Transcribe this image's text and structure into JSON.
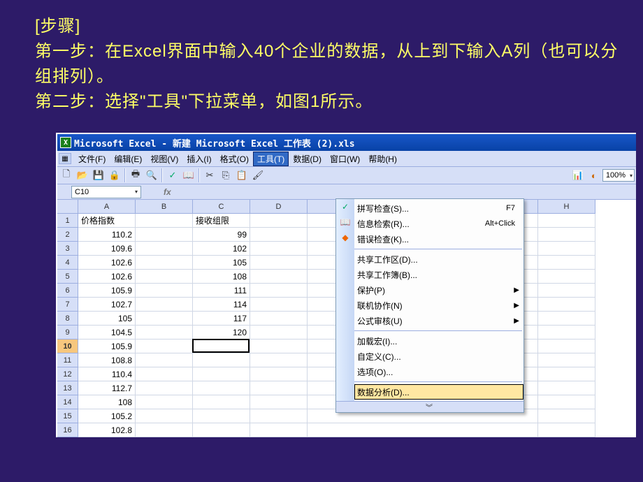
{
  "slide": {
    "heading": "[步骤]",
    "line1": "第一步：在Excel界面中输入40个企业的数据，从上到下输入A列（也可以分组排列）。",
    "line2": "第二步：选择\"工具\"下拉菜单，如图1所示。"
  },
  "title_bar": "Microsoft Excel - 新建 Microsoft Excel 工作表 (2).xls",
  "menu": {
    "file": "文件(F)",
    "edit": "编辑(E)",
    "view": "视图(V)",
    "insert": "插入(I)",
    "format": "格式(O)",
    "tools": "工具(T)",
    "data": "数据(D)",
    "window": "窗口(W)",
    "help": "帮助(H)"
  },
  "toolbar": {
    "zoom": "100%"
  },
  "namebox": "C10",
  "columns": {
    "A": "A",
    "B": "B",
    "C": "C",
    "D": "D",
    "H": "H"
  },
  "row_labels": [
    "1",
    "2",
    "3",
    "4",
    "5",
    "6",
    "7",
    "8",
    "9",
    "10",
    "11",
    "12",
    "13",
    "14",
    "15",
    "16"
  ],
  "cells": {
    "A1": "价格指数",
    "C1": "接收组限",
    "A2": "110.2",
    "C2": "99",
    "A3": "109.6",
    "C3": "102",
    "A4": "102.6",
    "C4": "105",
    "A5": "102.6",
    "C5": "108",
    "A6": "105.9",
    "C6": "111",
    "A7": "102.7",
    "C7": "114",
    "A8": "105",
    "C8": "117",
    "A9": "104.5",
    "C9": "120",
    "A10": "105.9",
    "A11": "108.8",
    "A12": "110.4",
    "A13": "112.7",
    "A14": "108",
    "A15": "105.2",
    "A16": "102.8"
  },
  "dropdown": {
    "spelling": "拼写检查(S)...",
    "spelling_sc": "F7",
    "research": "信息检索(R)...",
    "research_sc": "Alt+Click",
    "error": "错误检查(K)...",
    "workspace": "共享工作区(D)...",
    "workbook": "共享工作簿(B)...",
    "protect": "保护(P)",
    "collab": "联机协作(N)",
    "audit": "公式审核(U)",
    "addins": "加载宏(I)...",
    "customize": "自定义(C)...",
    "options": "选项(O)...",
    "analysis": "数据分析(D)..."
  }
}
